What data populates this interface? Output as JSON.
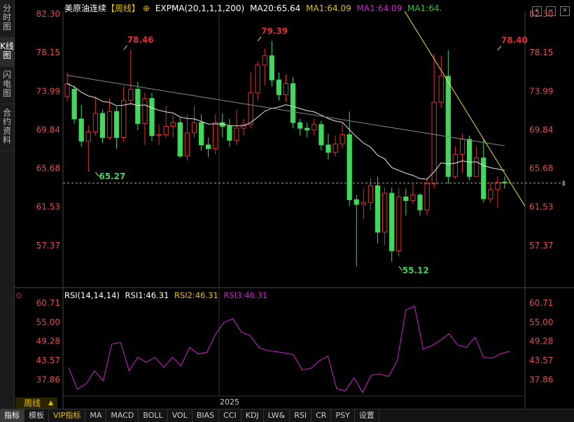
{
  "sidebar": {
    "tabs": [
      {
        "label": "分时图",
        "active": false
      },
      {
        "label": "K线图",
        "active": true
      },
      {
        "label": "闪电图",
        "active": false
      },
      {
        "label": "合约资料",
        "active": false
      }
    ]
  },
  "header": {
    "title": "美原油连续",
    "period": "【周线】",
    "indicator": "EXPMA(20,1,1,1,200)",
    "ma20": "MA20:65.64",
    "ma1a": "MA1:64.09",
    "ma1b": "MA1:64.09",
    "ma1c": "MA1:64.",
    "colors": {
      "ma1a": "#e8c000",
      "ma1b": "#d020d0",
      "ma1c": "#2ec32e"
    }
  },
  "window_buttons": [
    "+",
    "−",
    "×"
  ],
  "rsi_header": {
    "name": "RSI(14,14,14)",
    "rsi1": "RSI1:46.31",
    "rsi2": "RSI2:46.31",
    "rsi3": "RSI3:46.31"
  },
  "period_badge": "周线",
  "year_label": "2025",
  "tabs": [
    {
      "label": "指标",
      "active": true
    },
    {
      "label": "模板"
    },
    {
      "label": "VIP指标",
      "vip": true
    },
    {
      "label": "MA"
    },
    {
      "label": "MACD"
    },
    {
      "label": "BOLL"
    },
    {
      "label": "VOL"
    },
    {
      "label": "BIAS"
    },
    {
      "label": "CCI"
    },
    {
      "label": "KDJ"
    },
    {
      "label": "LW&"
    },
    {
      "label": "RSI"
    },
    {
      "label": "CR"
    },
    {
      "label": "PSY"
    },
    {
      "label": "设置"
    }
  ],
  "chart_data": [
    {
      "type": "candlestick",
      "title": "美原油连续 周线",
      "y_ticks": [
        "82.30",
        "78.15",
        "73.99",
        "69.84",
        "65.68",
        "61.53",
        "57.37"
      ],
      "ylim": [
        53.2,
        82.3
      ],
      "last_price": 64.09,
      "annotations": [
        {
          "label": "78.46",
          "value": 78.46,
          "kind": "high",
          "index": 14
        },
        {
          "label": "79.39",
          "value": 79.39,
          "kind": "high",
          "index": 46
        },
        {
          "label": "78.40",
          "value": 78.4,
          "kind": "high",
          "index": 102
        },
        {
          "label": "65.27",
          "value": 65.27,
          "kind": "low",
          "index": 6
        },
        {
          "label": "55.12",
          "value": 55.12,
          "kind": "low",
          "index": 78
        }
      ],
      "candles": [
        [
          73.4,
          74.8,
          76.0,
          72.9
        ],
        [
          74.2,
          71.0,
          74.6,
          70.5
        ],
        [
          71.0,
          68.6,
          72.5,
          68.0
        ],
        [
          68.6,
          69.6,
          70.3,
          65.27
        ],
        [
          69.6,
          71.6,
          73.4,
          69.2
        ],
        [
          71.6,
          69.0,
          72.0,
          68.4
        ],
        [
          69.0,
          71.8,
          73.2,
          68.8
        ],
        [
          71.8,
          69.0,
          72.3,
          67.8
        ],
        [
          69.0,
          73.0,
          74.5,
          68.5
        ],
        [
          73.0,
          74.2,
          78.46,
          72.5
        ],
        [
          74.2,
          70.5,
          75.0,
          69.8
        ],
        [
          70.5,
          73.2,
          73.8,
          68.2
        ],
        [
          73.2,
          69.2,
          73.8,
          68.6
        ],
        [
          69.2,
          69.3,
          70.4,
          68.2
        ],
        [
          69.3,
          70.2,
          72.4,
          69.0
        ],
        [
          70.2,
          70.6,
          71.4,
          69.0
        ],
        [
          70.6,
          67.0,
          71.2,
          66.8
        ],
        [
          67.0,
          69.5,
          71.5,
          66.5
        ],
        [
          69.5,
          70.6,
          72.4,
          69.0
        ],
        [
          70.6,
          68.2,
          71.5,
          67.6
        ],
        [
          68.2,
          67.8,
          69.0,
          66.9
        ],
        [
          67.8,
          70.6,
          71.5,
          67.2
        ],
        [
          70.6,
          70.2,
          71.6,
          69.0
        ],
        [
          70.2,
          68.7,
          71.0,
          68.0
        ],
        [
          68.7,
          70.0,
          72.0,
          68.2
        ],
        [
          70.0,
          70.4,
          71.0,
          69.2
        ],
        [
          70.4,
          73.8,
          76.0,
          70.0
        ],
        [
          73.8,
          76.8,
          77.2,
          73.0
        ],
        [
          76.8,
          77.8,
          78.6,
          74.6
        ],
        [
          77.8,
          75.2,
          79.39,
          74.5
        ],
        [
          75.2,
          73.6,
          76.0,
          73.0
        ],
        [
          73.6,
          74.8,
          75.8,
          72.8
        ],
        [
          74.8,
          70.6,
          75.5,
          70.0
        ],
        [
          70.6,
          70.0,
          71.0,
          69.2
        ],
        [
          70.0,
          69.8,
          70.6,
          69.0
        ],
        [
          69.8,
          70.4,
          71.0,
          69.2
        ],
        [
          70.4,
          68.2,
          70.8,
          67.6
        ],
        [
          68.2,
          67.4,
          69.4,
          66.6
        ],
        [
          67.4,
          68.3,
          69.2,
          67.0
        ],
        [
          68.3,
          69.3,
          70.6,
          67.8
        ],
        [
          69.3,
          62.3,
          71.8,
          61.6
        ],
        [
          62.3,
          61.8,
          62.8,
          55.12
        ],
        [
          61.8,
          62.0,
          63.5,
          60.2
        ],
        [
          62.0,
          63.8,
          64.6,
          61.2
        ],
        [
          63.8,
          58.8,
          64.8,
          57.6
        ],
        [
          58.8,
          63.0,
          63.6,
          57.4
        ],
        [
          63.0,
          56.8,
          63.6,
          55.6
        ],
        [
          56.8,
          62.6,
          63.6,
          56.2
        ],
        [
          62.6,
          62.2,
          63.5,
          60.6
        ],
        [
          62.2,
          62.8,
          64.0,
          61.8
        ],
        [
          62.8,
          61.2,
          63.0,
          60.6
        ],
        [
          61.2,
          64.0,
          64.5,
          60.6
        ],
        [
          64.0,
          72.8,
          78.0,
          63.5
        ],
        [
          72.8,
          75.6,
          77.8,
          72.2
        ],
        [
          75.6,
          64.8,
          78.4,
          64.0
        ],
        [
          64.8,
          67.2,
          68.0,
          64.6
        ],
        [
          67.2,
          68.8,
          69.4,
          65.2
        ],
        [
          68.8,
          64.8,
          69.2,
          64.4
        ],
        [
          64.8,
          66.8,
          68.0,
          64.8
        ],
        [
          66.8,
          62.4,
          68.8,
          62.0
        ],
        [
          62.4,
          63.4,
          64.2,
          62.0
        ],
        [
          63.4,
          64.2,
          64.8,
          61.4
        ],
        [
          64.2,
          64.09,
          64.8,
          63.5
        ]
      ]
    },
    {
      "type": "line",
      "title": "RSI(14,14,14)",
      "y_ticks": [
        "60.71",
        "55.00",
        "49.28",
        "43.57",
        "37.86"
      ],
      "ylim": [
        32.1,
        60.71
      ],
      "series": [
        {
          "name": "RSI1",
          "color": "#d020d0",
          "values": [
            41.5,
            35.0,
            36.5,
            40.5,
            37.5,
            48.5,
            49.0,
            40.5,
            44.5,
            43.0,
            44.5,
            41.5,
            44.5,
            42.0,
            47.5,
            45.5,
            46.0,
            51.5,
            55.0,
            56.0,
            52.0,
            51.0,
            47.5,
            46.5,
            46.2,
            45.8,
            45.3,
            40.8,
            41.2,
            43.5,
            44.8,
            35.2,
            34.5,
            38.4,
            34.0,
            39.2,
            39.5,
            38.8,
            43.5,
            58.6,
            59.8,
            47.0,
            48.0,
            49.6,
            51.5,
            48.2,
            47.5,
            50.5,
            44.5,
            44.3,
            45.6,
            46.31
          ]
        }
      ]
    }
  ]
}
